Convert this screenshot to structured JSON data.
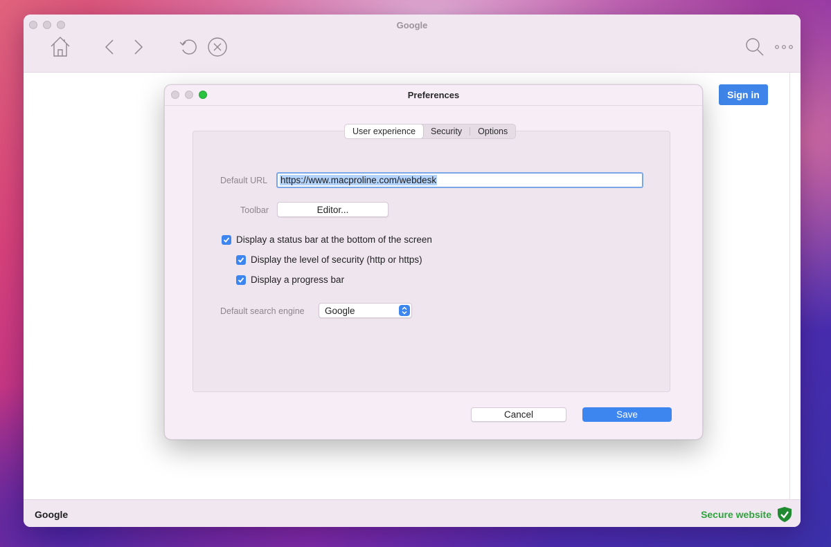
{
  "browser": {
    "title": "Google",
    "signin_label": "Sign in"
  },
  "toolbar": {
    "icons": [
      "home-icon",
      "back-icon",
      "forward-icon",
      "reload-icon",
      "stop-icon",
      "search-icon",
      "more-icon"
    ]
  },
  "statusbar": {
    "left_text": "Google",
    "right_text": "Secure website",
    "secure_color": "#2ea33c"
  },
  "dialog": {
    "title": "Preferences",
    "tabs": [
      {
        "label": "User experience",
        "active": true
      },
      {
        "label": "Security",
        "active": false
      },
      {
        "label": "Options",
        "active": false
      }
    ],
    "default_url_label": "Default URL",
    "default_url_value": "https://www.macproline.com/webdesk",
    "toolbar_label": "Toolbar",
    "editor_button": "Editor...",
    "checkboxes": [
      {
        "label": "Display a status bar at the bottom of the screen",
        "checked": true
      },
      {
        "label": "Display the level of security (http or https)",
        "checked": true
      },
      {
        "label": "Display a progress bar",
        "checked": true
      }
    ],
    "search_engine_label": "Default search engine",
    "search_engine_value": "Google",
    "cancel_label": "Cancel",
    "save_label": "Save"
  },
  "colors": {
    "accent": "#3d86f0",
    "signin": "#3f84e8"
  }
}
